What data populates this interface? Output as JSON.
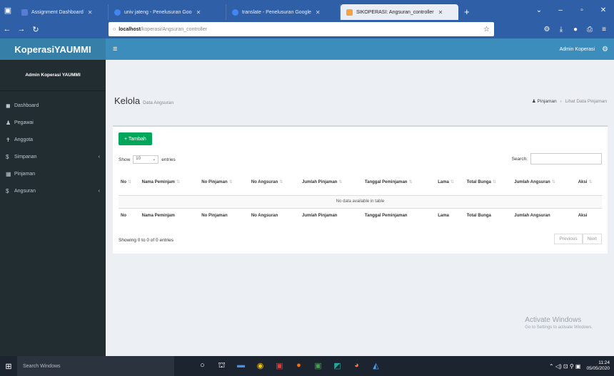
{
  "browser": {
    "tabs": [
      {
        "title": "Assignment Dashboard",
        "color": "#5b7bd5"
      },
      {
        "title": "univ jateng - Penelusuran Goo",
        "color": "#4285f4"
      },
      {
        "title": "translate - Penelusuran Google",
        "color": "#4285f4"
      },
      {
        "title": "SIKOPERASI: Angsuran_controller",
        "color": "#f4a340"
      }
    ],
    "url_host": "localhost",
    "url_path": "/koperasi/Angsuran_controller"
  },
  "app": {
    "brand": "KoperasiYAUMMI",
    "user": "Admin Koperasi",
    "sidebar_user": "Admin Koperasi YAUMMI",
    "sidebar": [
      {
        "label": "Dashboard",
        "icon": "dashboard-icon",
        "glyph": "◼"
      },
      {
        "label": "Pegawai",
        "icon": "users-icon",
        "glyph": "♟"
      },
      {
        "label": "Anggota",
        "icon": "person-icon",
        "glyph": "✝"
      },
      {
        "label": "Simpanan",
        "icon": "dollar-icon",
        "glyph": "$"
      },
      {
        "label": "Pinjaman",
        "icon": "grid-icon",
        "glyph": "▦"
      },
      {
        "label": "Angsuran",
        "icon": "dollar-icon",
        "glyph": "$"
      }
    ]
  },
  "page": {
    "title": "Kelola",
    "subtitle": "Data Angsuran",
    "breadcrumb": [
      "Pinjaman",
      "Lihat Data Pinjaman"
    ]
  },
  "table": {
    "add_label": "+ Tambah",
    "show_label": "Show",
    "entries_value": "10",
    "entries_label": "entries",
    "search_label": "Search:",
    "columns": [
      "No",
      "Nama Peminjam",
      "No Pinjaman",
      "No Angsuran",
      "Jumlah Pinjaman",
      "Tanggal Peminjaman",
      "Lama",
      "Total Bunga",
      "Jumlah Angsuran",
      "Aksi"
    ],
    "empty_text": "No data available in table",
    "info": "Showing 0 to 0 of 0 entries",
    "prev": "Previous",
    "next": "Next"
  },
  "watermark": {
    "line1": "Activate Windows",
    "line2": "Go to Settings to activate Windows."
  },
  "taskbar": {
    "search": "Search Windows",
    "time": "11:24",
    "date": "05/05/2020"
  }
}
